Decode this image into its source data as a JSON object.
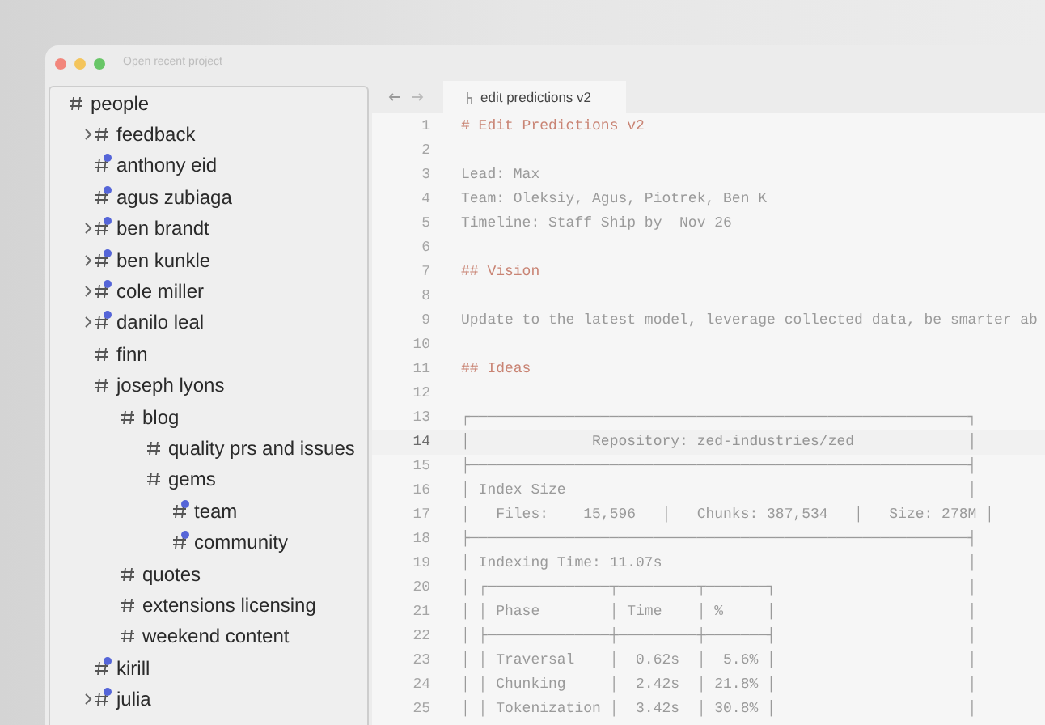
{
  "window": {
    "title": "Open recent project"
  },
  "tree": [
    {
      "label": "people",
      "indicator": false,
      "expandable": false,
      "children": [
        {
          "label": "feedback",
          "indicator": false,
          "expandable": true
        },
        {
          "label": "anthony eid",
          "indicator": true,
          "expandable": false
        },
        {
          "label": "agus zubiaga",
          "indicator": true,
          "expandable": false
        },
        {
          "label": "ben brandt",
          "indicator": true,
          "expandable": true
        },
        {
          "label": "ben kunkle",
          "indicator": true,
          "expandable": true
        },
        {
          "label": "cole miller",
          "indicator": true,
          "expandable": true
        },
        {
          "label": "danilo leal",
          "indicator": true,
          "expandable": true
        },
        {
          "label": "finn",
          "indicator": false,
          "expandable": false
        },
        {
          "label": "joseph lyons",
          "indicator": false,
          "expandable": false,
          "children": [
            {
              "label": "blog",
              "indicator": false,
              "expandable": false,
              "children": [
                {
                  "label": "quality prs and issues",
                  "indicator": false,
                  "expandable": false
                },
                {
                  "label": "gems",
                  "indicator": false,
                  "expandable": false,
                  "children": [
                    {
                      "label": "team",
                      "indicator": true,
                      "expandable": false
                    },
                    {
                      "label": "community",
                      "indicator": true,
                      "expandable": false
                    }
                  ]
                }
              ]
            },
            {
              "label": "quotes",
              "indicator": false,
              "expandable": false
            },
            {
              "label": "extensions licensing",
              "indicator": false,
              "expandable": false
            },
            {
              "label": "weekend content",
              "indicator": false,
              "expandable": false
            }
          ]
        },
        {
          "label": "kirill",
          "indicator": true,
          "expandable": false
        },
        {
          "label": "julia",
          "indicator": true,
          "expandable": true
        }
      ]
    }
  ],
  "editor": {
    "tab": {
      "title": "edit predictions v2"
    },
    "lines": [
      {
        "number": "1",
        "kind": "heading",
        "text": "# Edit Predictions v2"
      },
      {
        "number": "2",
        "kind": "body"
      },
      {
        "number": "3",
        "kind": "body",
        "text": "Lead: Max"
      },
      {
        "number": "4",
        "kind": "body",
        "text": "Team: Oleksiy, Agus, Piotrek, Ben K"
      },
      {
        "number": "5",
        "kind": "body",
        "text": "Timeline: Staff Ship by  Nov 26"
      },
      {
        "number": "6",
        "kind": "body"
      },
      {
        "number": "7",
        "kind": "heading",
        "text": "## Vision"
      },
      {
        "number": "8",
        "kind": "body"
      },
      {
        "number": "9",
        "kind": "body",
        "text": "Update to the latest model, leverage collected data, be smarter ab"
      },
      {
        "number": "10",
        "kind": "body"
      },
      {
        "number": "11",
        "kind": "heading",
        "text": "## Ideas"
      },
      {
        "number": "12",
        "kind": "body"
      },
      {
        "number": "13",
        "kind": "body",
        "text": "┌─────────────────────────────────────────────────────────┐"
      },
      {
        "number": "14",
        "kind": "current",
        "text": "│              Repository: zed-industries/zed             │"
      },
      {
        "number": "15",
        "kind": "body",
        "text": "├─────────────────────────────────────────────────────────┤"
      },
      {
        "number": "16",
        "kind": "body",
        "text": "│ Index Size                                              │"
      },
      {
        "number": "17",
        "kind": "body",
        "text": "│   Files:    15,596   │   Chunks: 387,534   │   Size: 278M │"
      },
      {
        "number": "18",
        "kind": "body",
        "text": "├─────────────────────────────────────────────────────────┤"
      },
      {
        "number": "19",
        "kind": "body",
        "text": "│ Indexing Time: 11.07s                                   │"
      },
      {
        "number": "20",
        "kind": "body",
        "text": "│ ┌──────────────┬─────────┬───────┐                      │"
      },
      {
        "number": "21",
        "kind": "body",
        "text": "│ │ Phase        │ Time    │ %     │                      │"
      },
      {
        "number": "22",
        "kind": "body",
        "text": "│ ├──────────────┼─────────┼───────┤                      │"
      },
      {
        "number": "23",
        "kind": "body",
        "text": "│ │ Traversal    │  0.62s  │  5.6% │                      │"
      },
      {
        "number": "24",
        "kind": "body",
        "text": "│ │ Chunking     │  2.42s  │ 21.8% │                      │"
      },
      {
        "number": "25",
        "kind": "body",
        "text": "│ │ Tokenization │  3.42s  │ 30.8% │                      │"
      }
    ]
  }
}
